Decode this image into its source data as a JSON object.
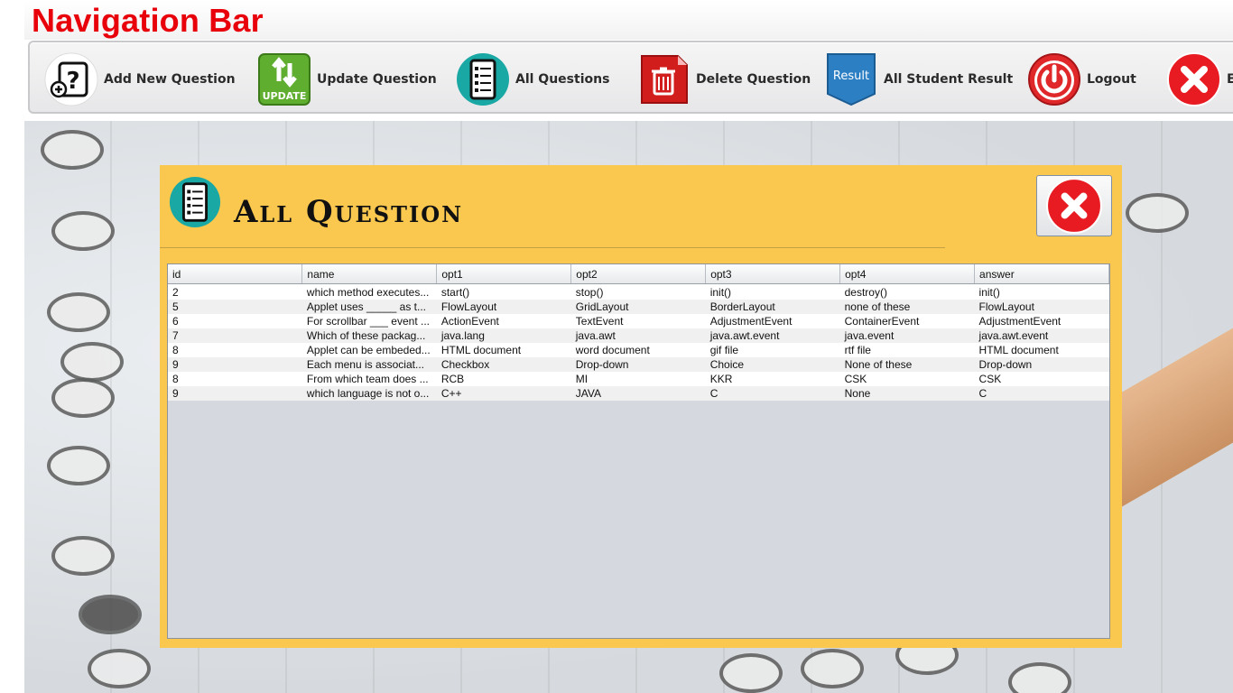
{
  "nav_title": "Navigation Bar",
  "toolbar": [
    {
      "label": "Add New Question",
      "icon": "add-question-icon"
    },
    {
      "label": "Update Question",
      "icon": "update-icon"
    },
    {
      "label": "All Questions",
      "icon": "question-list-icon"
    },
    {
      "label": "Delete Question",
      "icon": "trash-icon"
    },
    {
      "label": "All Student Result",
      "icon": "result-ribbon-icon"
    },
    {
      "label": "Logout",
      "icon": "power-icon"
    },
    {
      "label": "E",
      "icon": "exit-icon"
    }
  ],
  "panel": {
    "title": "All Question",
    "columns": [
      "id",
      "name",
      "opt1",
      "opt2",
      "opt3",
      "opt4",
      "answer"
    ],
    "rows": [
      [
        "2",
        "which method executes...",
        "start()",
        "stop()",
        "init()",
        "destroy()",
        "init()"
      ],
      [
        "5",
        "Applet uses _____ as t...",
        "FlowLayout",
        "GridLayout",
        "BorderLayout",
        "none of these",
        "FlowLayout"
      ],
      [
        "6",
        "For scrollbar ___ event ...",
        "ActionEvent",
        "TextEvent",
        "AdjustmentEvent",
        "ContainerEvent",
        "AdjustmentEvent"
      ],
      [
        "7",
        "Which of these packag...",
        "java.lang",
        "java.awt",
        "java.awt.event",
        "java.event",
        "java.awt.event"
      ],
      [
        "8",
        "Applet can be embeded...",
        "HTML document",
        "word document",
        "gif file",
        "rtf file",
        "HTML document"
      ],
      [
        "9",
        "Each menu is associat...",
        "Checkbox",
        "Drop-down",
        "Choice",
        "None of these",
        "Drop-down"
      ],
      [
        "8",
        "From which team does ...",
        "RCB",
        "MI",
        "KKR",
        "CSK",
        "CSK"
      ],
      [
        "9",
        "which language is not o...",
        "C++",
        "JAVA",
        "C",
        "None",
        "C"
      ]
    ]
  },
  "colors": {
    "title_red": "#e8000b",
    "panel_yellow": "#fac84e",
    "table_bg": "#d5d8df"
  }
}
